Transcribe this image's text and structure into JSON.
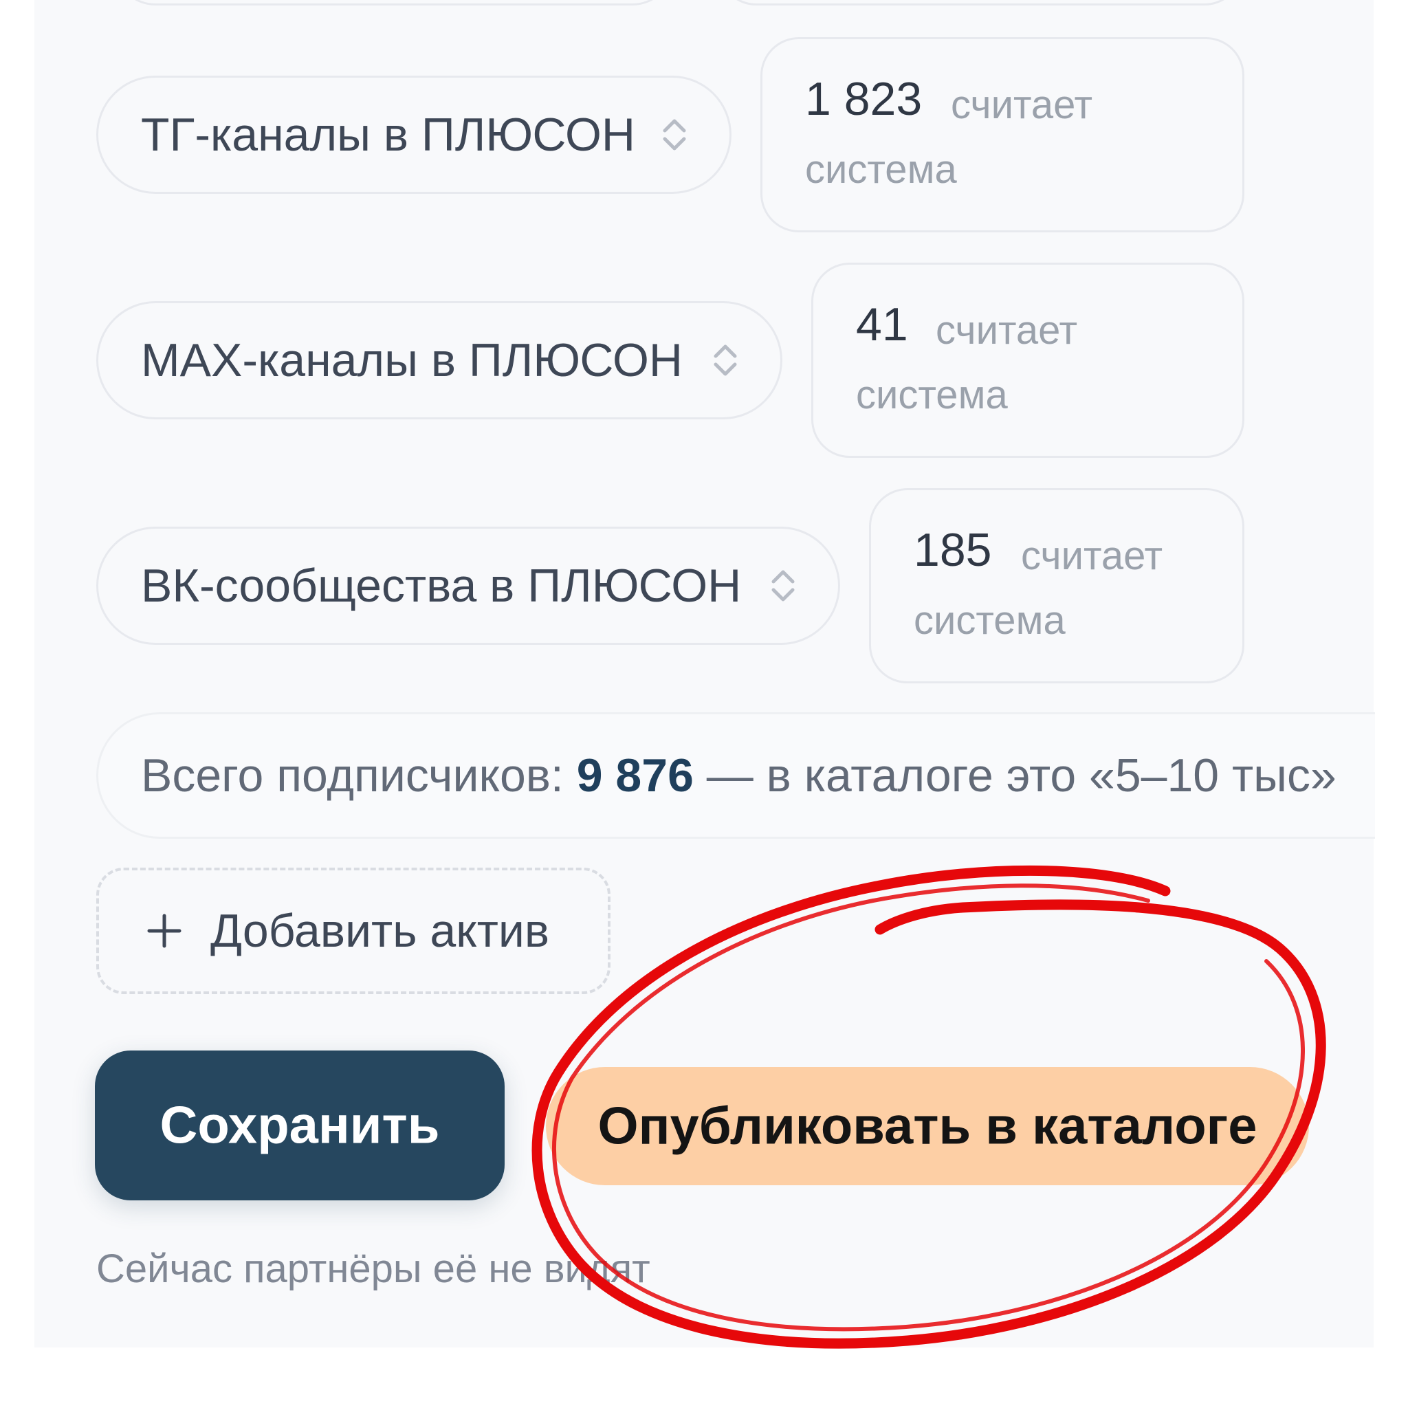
{
  "assets": [
    {
      "select_label": "ТГ-каналы в ПЛЮСОН",
      "count": "1 823",
      "count_suffix": "считает",
      "count_sub": "система"
    },
    {
      "select_label": "MAX-каналы в ПЛЮСОН",
      "count": "41",
      "count_suffix": "считает",
      "count_sub": "система"
    },
    {
      "select_label": "ВК-сообщества в ПЛЮСОН",
      "count": "185",
      "count_suffix": "считает",
      "count_sub": "система"
    }
  ],
  "summary": {
    "prefix": "Всего подписчиков: ",
    "value": "9 876",
    "suffix": " — в каталоге это «5–10 тыс»"
  },
  "add_asset_label": "Добавить актив",
  "save_label": "Сохранить",
  "publish_label": "Опубликовать в каталоге",
  "hint": "Сейчас партнёры её не видят",
  "colors": {
    "primary": "#26475f",
    "accent": "#fdcfa5",
    "annotation": "#e6080a"
  },
  "icons": [
    "chevron-up-down-icon",
    "plus-icon"
  ]
}
